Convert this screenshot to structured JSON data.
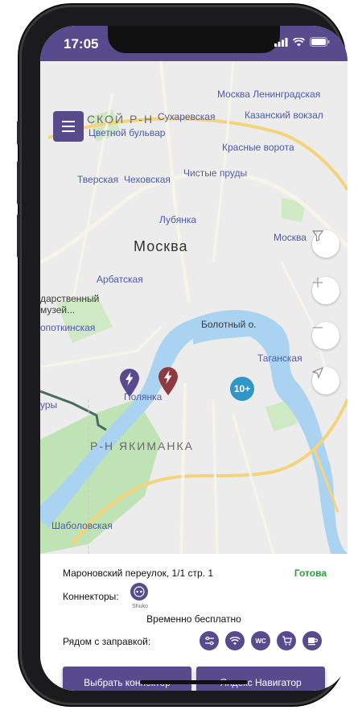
{
  "status_bar": {
    "time": "17:05"
  },
  "map": {
    "labels": {
      "moskva": "Москва",
      "district_top": "СКОЙ Р-Н",
      "district_yakimanka": "Р-Н ЯКИМАНКА",
      "metro_leningradskaya": "Москва Ленинградская",
      "metro_sukharevskaya": "Сухаревская",
      "metro_kazansky": "Казанский вокзал",
      "metro_tsvetnoy": "Цветной бульвар",
      "metro_krasnye_vorota": "Красные ворота",
      "metro_tverskaya": "Тверская",
      "metro_chekhovskaya": "Чеховская",
      "metro_chistye_prudy": "Чистые пруды",
      "metro_lubyanka": "Лубянка",
      "metro_moskva_right": "Москва",
      "metro_arbatskaya": "Арбатская",
      "museum": "дарственный музей...",
      "metro_kropotkinskaya": "опоткинская",
      "bolotny": "Болотный о.",
      "metro_taganskaya": "Таганская",
      "metro_polyanka": "Полянка",
      "metro_shabolovskaya": "Шаболовская",
      "metro_ury": "уры"
    },
    "cluster_count": "10+"
  },
  "station": {
    "address": "Мароновский переулок, 1/1 стр. 1",
    "status": "Готова",
    "connectors_label": "Коннекторы:",
    "connector_name": "Shuko",
    "price": "Временно бесплатно",
    "nearby_label": "Рядом с заправкой:",
    "amenities": [
      "settings-icon",
      "wifi-icon",
      "wc-icon",
      "cart-icon",
      "coffee-icon"
    ],
    "wc_text": "WC"
  },
  "actions": {
    "choose_connector": "Выбрать коннектор",
    "navigator": "Яндекс Навигатор"
  },
  "colors": {
    "accent": "#574b8d",
    "ready": "#2a9d3a",
    "cluster": "#2f96c8",
    "water": "#a9d3f0",
    "park": "#bfe3b4"
  }
}
